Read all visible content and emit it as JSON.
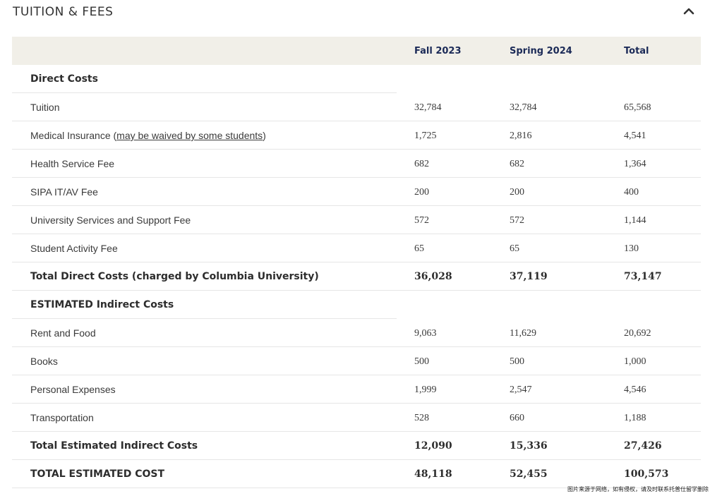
{
  "section": {
    "title": "TUITION & FEES",
    "toggle_icon": "chevron-up-icon"
  },
  "columns": [
    "Fall 2023",
    "Spring 2024",
    "Total"
  ],
  "rows": [
    {
      "label": "Direct Costs",
      "type": "section"
    },
    {
      "label": "Tuition",
      "values": [
        "32,784",
        "32,784",
        "65,568"
      ]
    },
    {
      "label_prefix": "Medical Insurance (",
      "label_link": "may be waived by some students",
      "label_suffix": ")",
      "values": [
        "1,725",
        "2,816",
        "4,541"
      ]
    },
    {
      "label": "Health Service Fee",
      "values": [
        "682",
        "682",
        "1,364"
      ]
    },
    {
      "label": "SIPA IT/AV Fee",
      "values": [
        "200",
        "200",
        "400"
      ]
    },
    {
      "label": "University Services and Support Fee",
      "values": [
        "572",
        "572",
        "1,144"
      ]
    },
    {
      "label": "Student Activity Fee",
      "values": [
        "65",
        "65",
        "130"
      ]
    },
    {
      "label": "Total Direct Costs (charged by Columbia University)",
      "type": "total",
      "values": [
        "36,028",
        "37,119",
        "73,147"
      ]
    },
    {
      "label": "ESTIMATED Indirect Costs",
      "type": "section"
    },
    {
      "label": "Rent and Food",
      "values": [
        "9,063",
        "11,629",
        "20,692"
      ]
    },
    {
      "label": "Books",
      "values": [
        "500",
        "500",
        "1,000"
      ]
    },
    {
      "label": "Personal Expenses",
      "values": [
        "1,999",
        "2,547",
        "4,546"
      ]
    },
    {
      "label": "Transportation",
      "values": [
        "528",
        "660",
        "1,188"
      ]
    },
    {
      "label": "Total Estimated Indirect Costs",
      "type": "total",
      "values": [
        "12,090",
        "15,336",
        "27,426"
      ]
    },
    {
      "label": "TOTAL ESTIMATED COST",
      "type": "total",
      "values": [
        "48,118",
        "52,455",
        "100,573"
      ]
    }
  ],
  "watermark": "图片来源于网络，如有侵权，请及时联系托普仕留学删除"
}
